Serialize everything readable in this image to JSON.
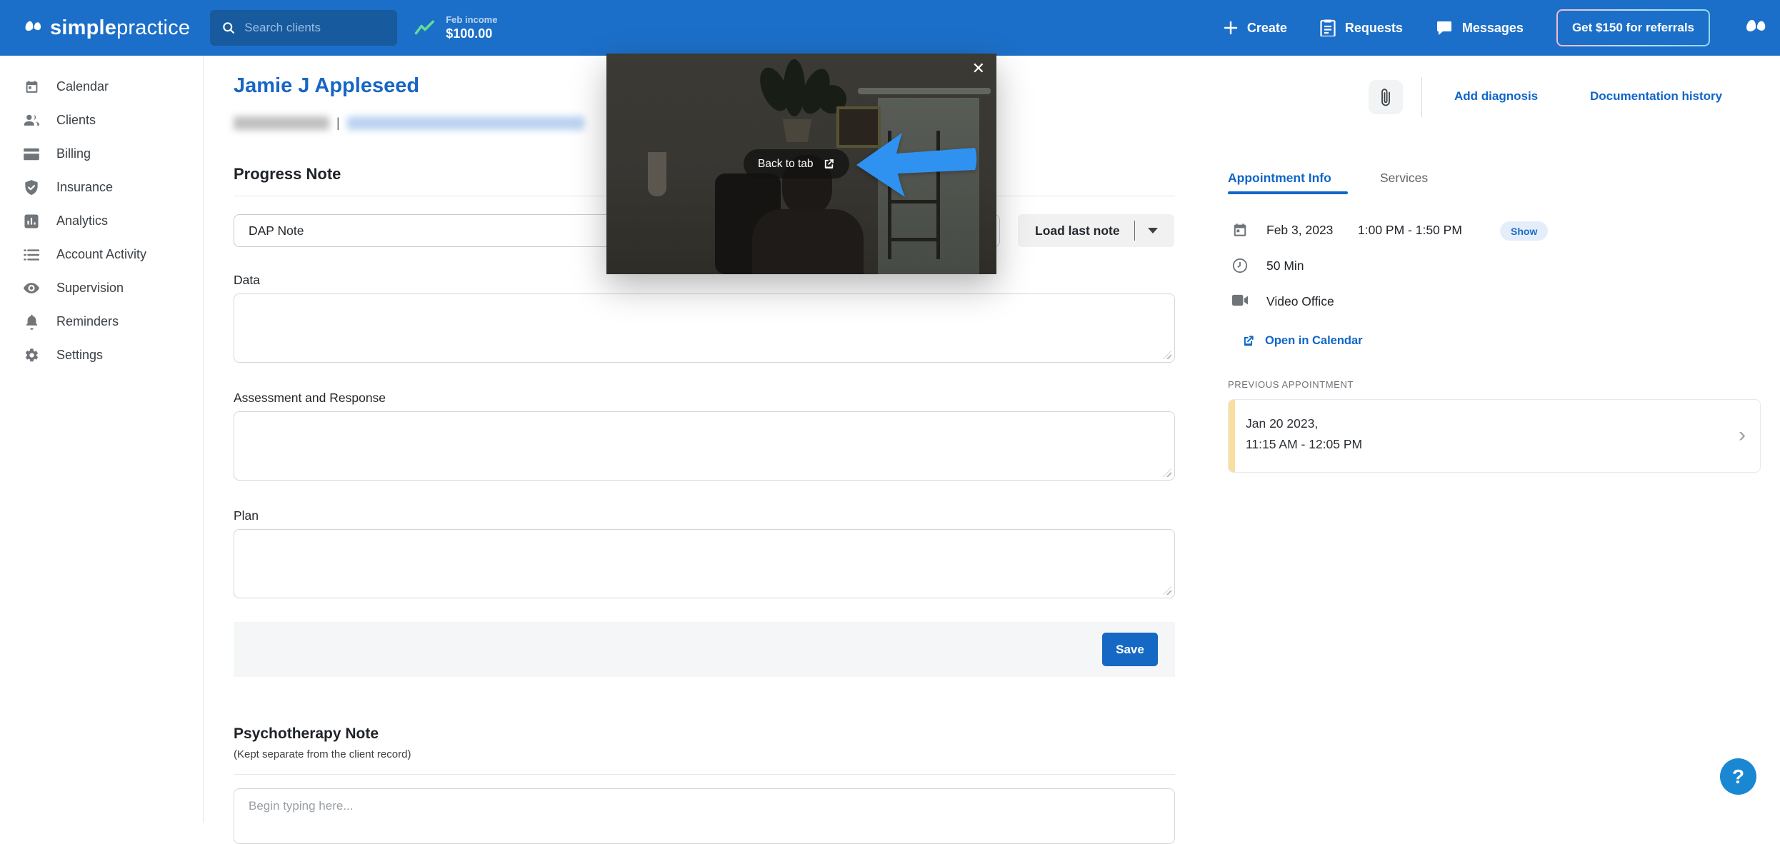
{
  "colors": {
    "navbar_blue": "#1C6FC8",
    "search_inset_blue": "#175A9E",
    "link_blue": "#1065C8",
    "client_name_blue": "#1766C4",
    "save_blue": "#1568C4",
    "arrow_annotation_blue": "#2F92F0",
    "help_blue": "#1A87D3",
    "badge_bg": "#E4EEFB",
    "badge_text": "#1D6AC9",
    "prev_stripe_yellow": "#F8DFA0",
    "trend_green": "#66DB94"
  },
  "navbar": {
    "brand_bold": "simple",
    "brand_light": "practice",
    "search_placeholder": "Search clients",
    "income_label": "Feb income",
    "income_value": "$100.00",
    "create": "Create",
    "requests": "Requests",
    "messages": "Messages",
    "referral": "Get $150 for referrals"
  },
  "sidebar": {
    "items": [
      {
        "label": "Calendar"
      },
      {
        "label": "Clients"
      },
      {
        "label": "Billing"
      },
      {
        "label": "Insurance"
      },
      {
        "label": "Analytics"
      },
      {
        "label": "Account Activity"
      },
      {
        "label": "Supervision"
      },
      {
        "label": "Reminders"
      },
      {
        "label": "Settings"
      }
    ]
  },
  "client": {
    "name": "Jamie J Appleseed"
  },
  "progress_note": {
    "title": "Progress Note",
    "template_value": "DAP Note",
    "load_last_note": "Load last note",
    "field1": "Data",
    "field2": "Assessment and Response",
    "field3": "Plan",
    "save": "Save"
  },
  "psychotherapy_note": {
    "title": "Psychotherapy Note",
    "subtitle": "(Kept separate from the client record)",
    "placeholder": "Begin typing here..."
  },
  "video_overlay": {
    "back_to_tab": "Back to tab",
    "close": "✕"
  },
  "right_panel": {
    "add_diagnosis": "Add diagnosis",
    "documentation_history": "Documentation history",
    "tab_appointment": "Appointment Info",
    "tab_services": "Services",
    "appointment": {
      "date": "Feb 3, 2023",
      "time": "1:00 PM - 1:50 PM",
      "badge": "Show",
      "duration": "50 Min",
      "location": "Video Office",
      "open_in_calendar": "Open in Calendar"
    },
    "previous": {
      "heading": "PREVIOUS APPOINTMENT",
      "date": "Jan 20 2023,",
      "time": "11:15 AM - 12:05 PM",
      "chevron": "›"
    }
  },
  "help": {
    "label": "?"
  }
}
